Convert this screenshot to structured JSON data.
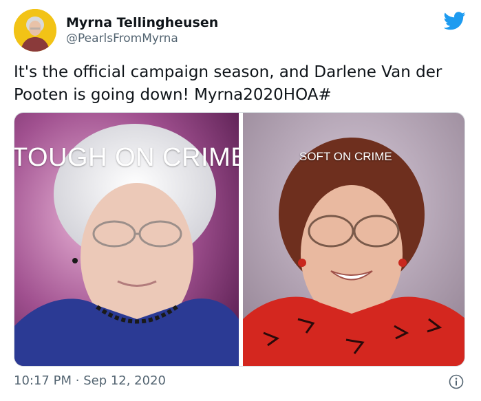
{
  "author": {
    "display_name": "Myrna Tellingheusen",
    "handle": "@PearlsFromMyrna",
    "avatar": "avatar-photo"
  },
  "tweet": {
    "text": "It's the official campaign season, and Darlene Van der Pooten is going down! Myrna2020HOA#",
    "time": "10:17 PM",
    "separator": "·",
    "date": "Sep 12, 2020"
  },
  "media": {
    "left_caption": "TOUGH ON CRIME",
    "right_caption": "SOFT ON CRIME"
  },
  "icons": {
    "brand": "twitter-bird-icon",
    "info": "info-icon"
  },
  "colors": {
    "brand_blue": "#1d9bf0",
    "text_primary": "#0f1419",
    "text_secondary": "#536471"
  }
}
